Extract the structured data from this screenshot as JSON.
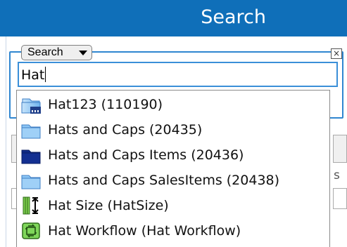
{
  "header": {
    "title": "Search"
  },
  "search_type": {
    "selected": "Search"
  },
  "search_input": {
    "value": "Hat"
  },
  "dropdown": {
    "items": [
      {
        "label": "Hat123 (110190)",
        "icon": "database-table-icon"
      },
      {
        "label": "Hats and Caps (20435)",
        "icon": "light-folder-icon"
      },
      {
        "label": "Hats and Caps Items (20436)",
        "icon": "dark-folder-icon"
      },
      {
        "label": "Hats and Caps SalesItems (20438)",
        "icon": "light-folder-icon"
      },
      {
        "label": "Hat Size (HatSize)",
        "icon": "field-size-icon"
      },
      {
        "label": "Hat Workflow (Hat Workflow)",
        "icon": "workflow-icon"
      }
    ]
  },
  "background": {
    "partial_text": "s"
  },
  "close_glyph": "×"
}
